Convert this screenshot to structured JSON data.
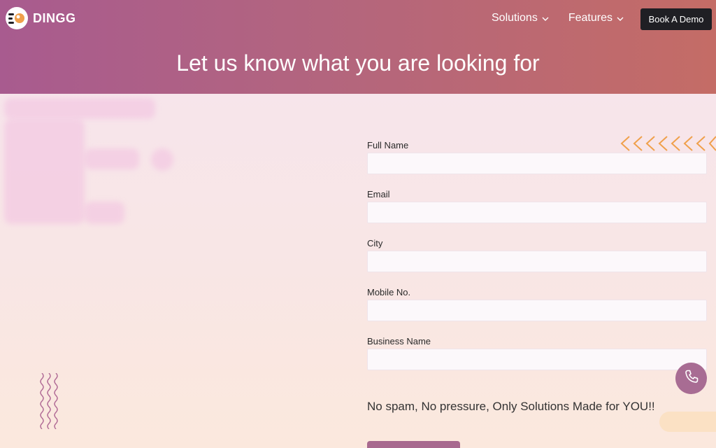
{
  "header": {
    "brand": "DINGG",
    "nav": [
      {
        "label": "Solutions"
      },
      {
        "label": "Features"
      }
    ],
    "cta_label": "Book A Demo",
    "title": "Let us know what you are looking for"
  },
  "form": {
    "fields": [
      {
        "label": "Full Name",
        "value": ""
      },
      {
        "label": "Email",
        "value": ""
      },
      {
        "label": "City",
        "value": ""
      },
      {
        "label": "Mobile No.",
        "value": ""
      },
      {
        "label": "Business Name",
        "value": ""
      }
    ],
    "tagline": "No spam, No pressure, Only Solutions Made for YOU!!"
  },
  "colors": {
    "hero_start": "#a85b8f",
    "hero_end": "#c46c66",
    "accent_arrows": "#f0a04b",
    "phone_button": "#a86c93"
  },
  "icons": {
    "logo": "dingg-logo-icon",
    "chevron": "chevron-down-icon",
    "phone": "phone-icon"
  }
}
